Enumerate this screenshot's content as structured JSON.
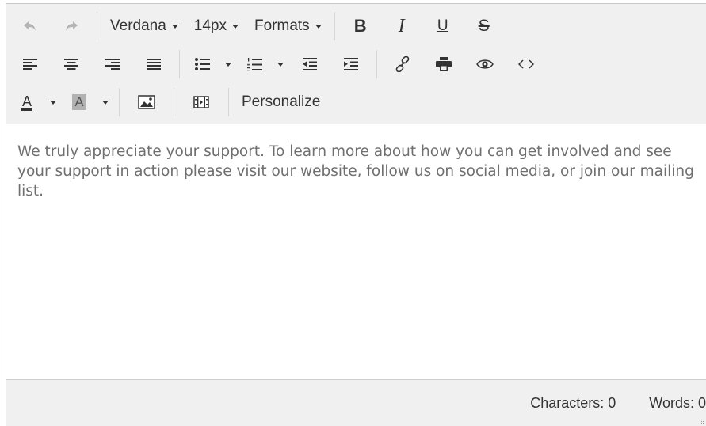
{
  "toolbar": {
    "font_family": "Verdana",
    "font_size": "14px",
    "formats_label": "Formats",
    "bold_label": "B",
    "italic_label": "I",
    "underline_label": "U",
    "strike_label": "S",
    "text_color_label": "A",
    "bg_color_label": "A",
    "personalize_label": "Personalize",
    "icons": {
      "undo": "undo-icon",
      "redo": "redo-icon",
      "align_left": "align-left-icon",
      "align_center": "align-center-icon",
      "align_right": "align-right-icon",
      "align_justify": "align-justify-icon",
      "bullet_list": "bullet-list-icon",
      "numbered_list": "numbered-list-icon",
      "outdent": "outdent-icon",
      "indent": "indent-icon",
      "link": "link-icon",
      "print": "print-icon",
      "preview": "eye-icon",
      "code": "code-icon",
      "image": "image-icon",
      "media": "film-icon"
    },
    "colors": {
      "toolbar_bg": "#f0f0f0",
      "icon": "#333333",
      "disabled": "#b4b4b4"
    }
  },
  "content": {
    "text": "We truly appreciate your support. To learn more about how you can get involved and see your support in action please visit our website, follow us on social media, or join our mailing list."
  },
  "statusbar": {
    "characters": "Characters: 0",
    "words": "Words: 0"
  }
}
